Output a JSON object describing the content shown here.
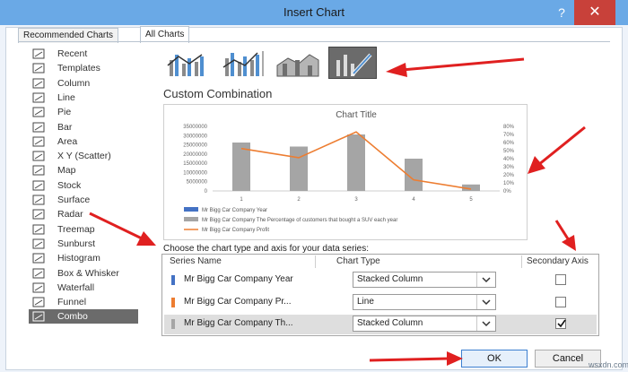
{
  "window": {
    "title": "Insert Chart",
    "help": "?",
    "close": "✕"
  },
  "tabs": [
    {
      "label": "Recommended Charts"
    },
    {
      "label": "All Charts"
    }
  ],
  "sidebar": {
    "items": [
      {
        "label": "Recent",
        "icon": "recent-icon"
      },
      {
        "label": "Templates",
        "icon": "folder-icon"
      },
      {
        "label": "Column",
        "icon": "column-chart-icon"
      },
      {
        "label": "Line",
        "icon": "line-chart-icon"
      },
      {
        "label": "Pie",
        "icon": "pie-chart-icon"
      },
      {
        "label": "Bar",
        "icon": "bar-chart-icon"
      },
      {
        "label": "Area",
        "icon": "area-chart-icon"
      },
      {
        "label": "X Y (Scatter)",
        "icon": "scatter-chart-icon"
      },
      {
        "label": "Map",
        "icon": "map-icon"
      },
      {
        "label": "Stock",
        "icon": "stock-chart-icon"
      },
      {
        "label": "Surface",
        "icon": "surface-chart-icon"
      },
      {
        "label": "Radar",
        "icon": "radar-chart-icon"
      },
      {
        "label": "Treemap",
        "icon": "treemap-icon"
      },
      {
        "label": "Sunburst",
        "icon": "sunburst-icon"
      },
      {
        "label": "Histogram",
        "icon": "histogram-icon"
      },
      {
        "label": "Box & Whisker",
        "icon": "box-whisker-icon"
      },
      {
        "label": "Waterfall",
        "icon": "waterfall-icon"
      },
      {
        "label": "Funnel",
        "icon": "funnel-icon"
      },
      {
        "label": "Combo",
        "icon": "combo-chart-icon"
      }
    ],
    "active_index": 18
  },
  "combo_types": [
    {
      "name": "clustered-column-line",
      "selected": false
    },
    {
      "name": "clustered-column-line-secondary",
      "selected": false
    },
    {
      "name": "stacked-area-clustered-column",
      "selected": false
    },
    {
      "name": "custom-combination",
      "selected": true
    }
  ],
  "section_title": "Custom Combination",
  "chart_data": {
    "type": "bar",
    "title": "Chart Title",
    "categories": [
      "1",
      "2",
      "3",
      "4",
      "5"
    ],
    "y_ticks": [
      "0",
      "5000000",
      "10000000",
      "15000000",
      "20000000",
      "25000000",
      "30000000",
      "35000000"
    ],
    "y2_ticks": [
      "0%",
      "10%",
      "20%",
      "30%",
      "40%",
      "50%",
      "60%",
      "70%",
      "80%"
    ],
    "ylim": [
      0,
      35000000
    ],
    "y2lim": [
      0,
      80
    ],
    "series": [
      {
        "name": "Mr Bigg Car Company Year",
        "type": "column",
        "values": [
          0,
          0,
          0,
          0,
          0
        ],
        "color": "#4472c4"
      },
      {
        "name": "Mr Bigg Car Company The Percentage of customers that  bought a SUV each year",
        "type": "column",
        "axis": "secondary",
        "values": [
          60,
          55,
          70,
          40,
          8
        ],
        "color": "#a5a5a5"
      },
      {
        "name": "Mr Bigg Car Company Profit",
        "type": "line",
        "values": [
          23000000,
          18000000,
          32000000,
          6000000,
          1000000
        ],
        "color": "#ed7d31"
      }
    ],
    "legend": "bottom",
    "grid": false
  },
  "series_table": {
    "instruction": "Choose the chart type and axis for your data series:",
    "headers": {
      "name": "Series Name",
      "type": "Chart Type",
      "axis": "Secondary Axis"
    },
    "rows": [
      {
        "name": "Mr Bigg Car Company Year",
        "type": "Stacked Column",
        "secondary": false,
        "color": "#4472c4",
        "highlighted": false
      },
      {
        "name": "Mr Bigg Car Company Pr...",
        "type": "Line",
        "secondary": false,
        "color": "#ed7d31",
        "highlighted": false
      },
      {
        "name": "Mr Bigg Car Company Th...",
        "type": "Stacked Column",
        "secondary": true,
        "color": "#a5a5a5",
        "highlighted": true
      }
    ]
  },
  "buttons": {
    "ok": "OK",
    "cancel": "Cancel"
  },
  "watermark": "wsxdn.com",
  "colors": {
    "accent": "#6aa9e6",
    "close": "#c8413a",
    "annotation": "#e02020"
  }
}
